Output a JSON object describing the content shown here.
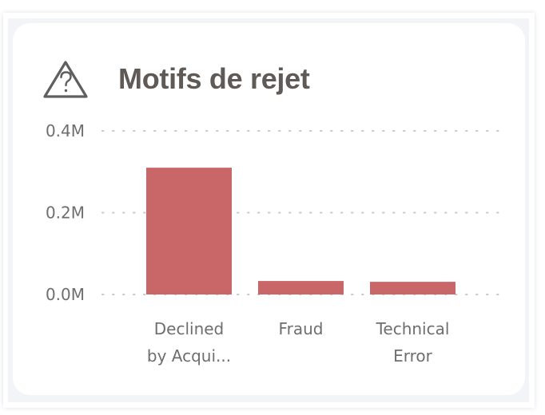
{
  "visual": {
    "title": "Motifs de rejet",
    "icon": "warning-question-icon"
  },
  "colors": {
    "bar": "#c96667",
    "title": "#605a57",
    "axis_text": "#6e6e6e",
    "gridline": "#c8c8c8",
    "background": "#f3f4f8"
  },
  "chart_data": {
    "type": "bar",
    "title": "Motifs de rejet",
    "xlabel": "",
    "ylabel": "",
    "categories": [
      "Declined by Acquirer",
      "Fraud",
      "Technical Error"
    ],
    "category_labels": [
      [
        "Declined",
        "by Acqui..."
      ],
      [
        "Fraud"
      ],
      [
        "Technical",
        "Error"
      ]
    ],
    "values": [
      310000,
      33000,
      31000
    ],
    "ylim": [
      0,
      400000
    ],
    "yticks": [
      0,
      200000,
      400000
    ],
    "ytick_labels": [
      "0.0M",
      "0.2M",
      "0.4M"
    ],
    "grid": true,
    "grid_style": "dotted",
    "legend": "none"
  }
}
